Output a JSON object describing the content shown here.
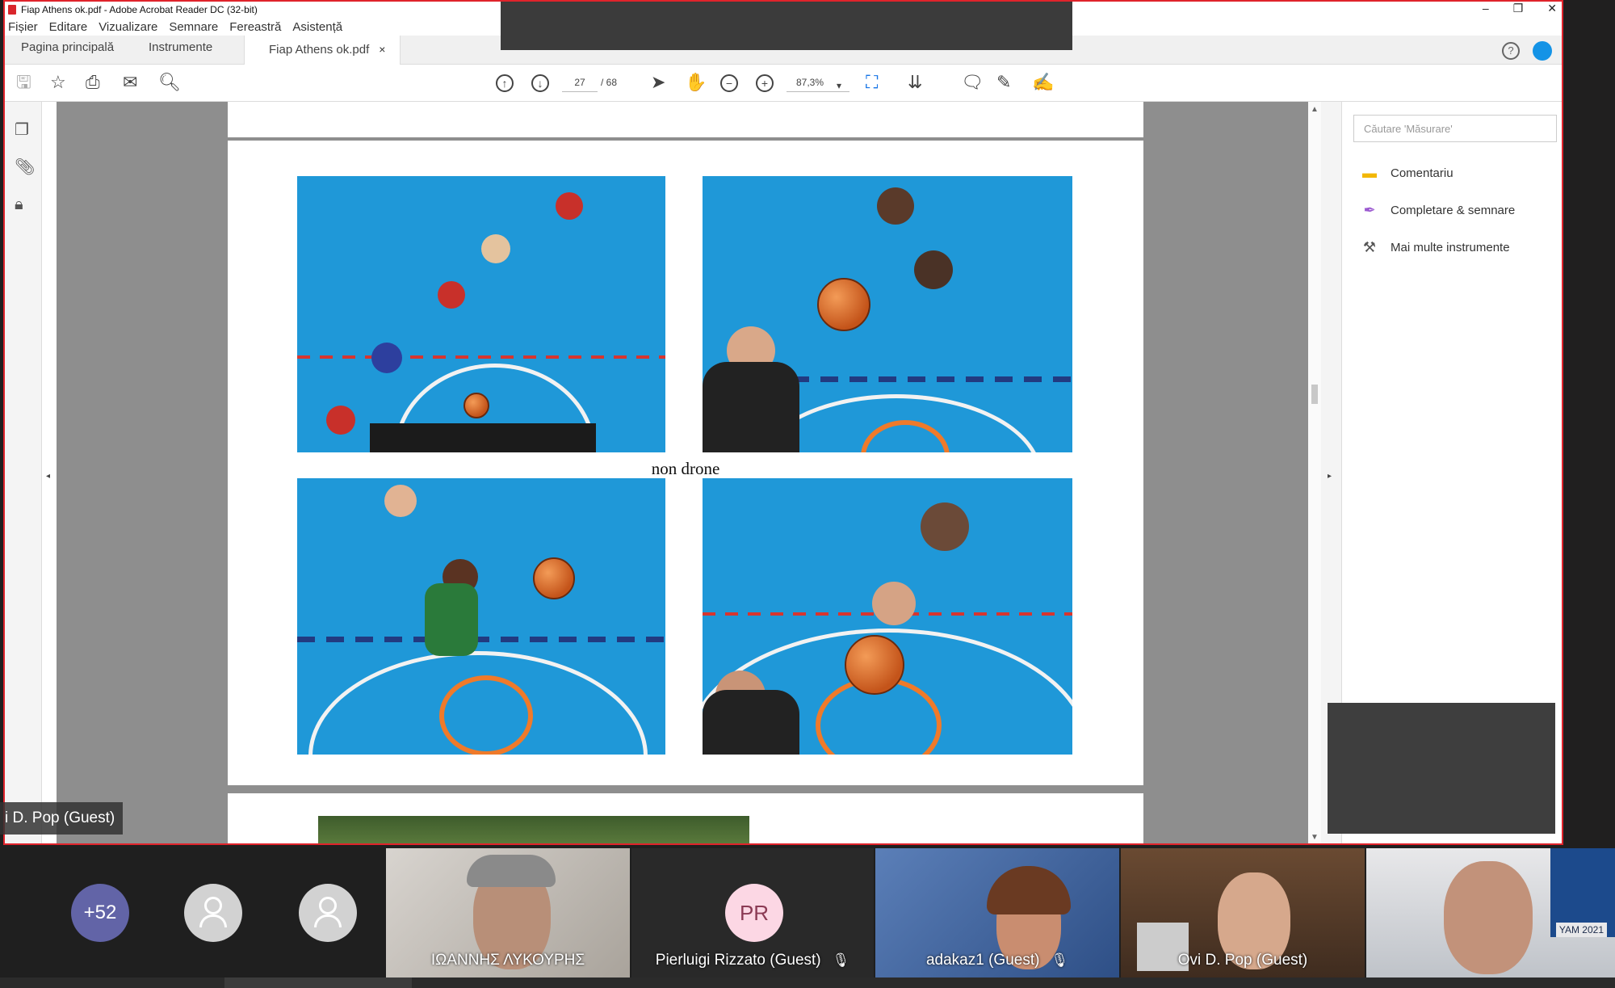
{
  "window": {
    "title": "Fiap Athens ok.pdf - Adobe Acrobat Reader DC (32-bit)",
    "min": "–",
    "restore": "❐",
    "close": "✕"
  },
  "menu": [
    "Fișier",
    "Editare",
    "Vizualizare",
    "Semnare",
    "Fereastră",
    "Asistență"
  ],
  "tabs": {
    "home": "Pagina principală",
    "tools": "Instrumente",
    "document": "Fiap Athens ok.pdf",
    "close": "×"
  },
  "toolbar": {
    "page_current": "27",
    "page_total": "/ 68",
    "zoom": "87,3%"
  },
  "document": {
    "caption": "non drone"
  },
  "right_panel": {
    "search_placeholder": "Căutare 'Măsurare'",
    "tools": [
      {
        "label": "Comentariu",
        "icon": "comment-icon",
        "color": "#f2b705"
      },
      {
        "label": "Completare & semnare",
        "icon": "fill-sign-icon",
        "color": "#9b59d0"
      },
      {
        "label": "Mai multe instrumente",
        "icon": "more-tools-icon",
        "color": "#555555"
      }
    ]
  },
  "meeting": {
    "presenter_label": "i D. Pop (Guest)",
    "overflow_count": "+52",
    "participants": [
      {
        "name": "ΙΩΑΝΝΗΣ ΛΥΚΟΥΡΗΣ",
        "muted": false
      },
      {
        "name": "Pierluigi Rizzato (Guest)",
        "initials": "PR",
        "muted": true
      },
      {
        "name": "adakaz1 (Guest)",
        "muted": true
      },
      {
        "name": "Ovi D. Pop (Guest)",
        "muted": false
      },
      {
        "name": "",
        "banner": "YAM 2021",
        "muted": false
      }
    ]
  },
  "colors": {
    "accent_red": "#e0232b",
    "teams_purple": "#6264a7",
    "court_blue": "#1f98d8"
  }
}
